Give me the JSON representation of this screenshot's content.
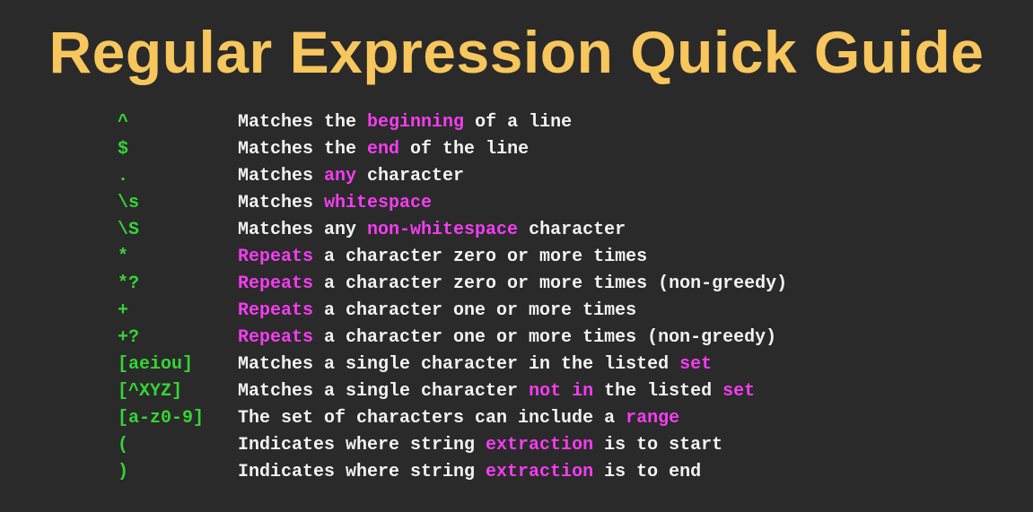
{
  "title": "Regular Expression Quick Guide",
  "colors": {
    "background": "#2a2a2a",
    "title": "#f7c65c",
    "symbol": "#33d633",
    "text": "#f2f2f2",
    "highlight": "#f53cf2"
  },
  "rows": [
    {
      "symbol": "^",
      "parts": [
        [
          "Matches the ",
          false
        ],
        [
          "beginning",
          true
        ],
        [
          " of a line",
          false
        ]
      ]
    },
    {
      "symbol": "$",
      "parts": [
        [
          "Matches the ",
          false
        ],
        [
          "end",
          true
        ],
        [
          " of the line",
          false
        ]
      ]
    },
    {
      "symbol": ".",
      "parts": [
        [
          "Matches ",
          false
        ],
        [
          "any",
          true
        ],
        [
          " character",
          false
        ]
      ]
    },
    {
      "symbol": "\\s",
      "parts": [
        [
          "Matches ",
          false
        ],
        [
          "whitespace",
          true
        ]
      ]
    },
    {
      "symbol": "\\S",
      "parts": [
        [
          "Matches any ",
          false
        ],
        [
          "non-whitespace",
          true
        ],
        [
          " character",
          false
        ]
      ]
    },
    {
      "symbol": "*",
      "parts": [
        [
          "Repeats",
          true
        ],
        [
          " a character zero or more times",
          false
        ]
      ]
    },
    {
      "symbol": "*?",
      "parts": [
        [
          "Repeats",
          true
        ],
        [
          " a character zero or more times (non-greedy)",
          false
        ]
      ]
    },
    {
      "symbol": "+",
      "parts": [
        [
          "Repeats",
          true
        ],
        [
          " a character one or more times",
          false
        ]
      ]
    },
    {
      "symbol": "+?",
      "parts": [
        [
          "Repeats",
          true
        ],
        [
          " a character one or more times (non-greedy)",
          false
        ]
      ]
    },
    {
      "symbol": "[aeiou]",
      "parts": [
        [
          "Matches a single character in the listed ",
          false
        ],
        [
          "set",
          true
        ]
      ]
    },
    {
      "symbol": "[^XYZ]",
      "parts": [
        [
          "Matches a single character ",
          false
        ],
        [
          "not in",
          true
        ],
        [
          " the listed ",
          false
        ],
        [
          "set",
          true
        ]
      ]
    },
    {
      "symbol": "[a-z0-9]",
      "parts": [
        [
          "The set of characters can include a ",
          false
        ],
        [
          "range",
          true
        ]
      ]
    },
    {
      "symbol": "(",
      "parts": [
        [
          "Indicates where string ",
          false
        ],
        [
          "extraction",
          true
        ],
        [
          " is to start",
          false
        ]
      ]
    },
    {
      "symbol": ")",
      "parts": [
        [
          "Indicates where string ",
          false
        ],
        [
          "extraction",
          true
        ],
        [
          " is to end",
          false
        ]
      ]
    }
  ]
}
